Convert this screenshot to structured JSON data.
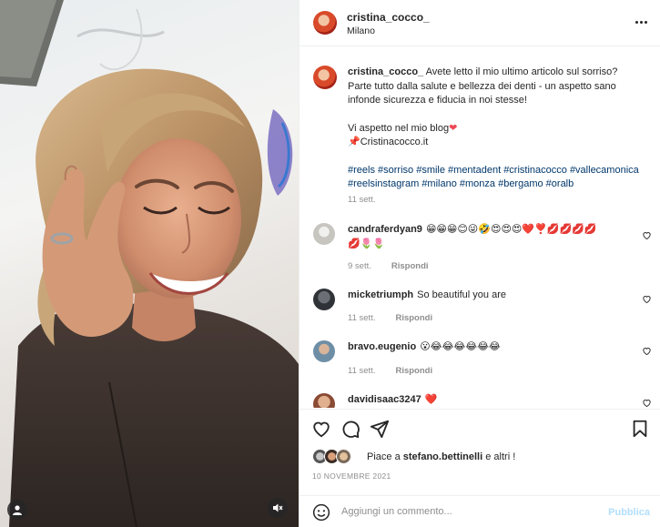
{
  "post": {
    "username": "cristina_cocco_",
    "location": "Milano",
    "caption_line1": "Avete letto il mio ultimo articolo sul sorriso?",
    "caption_line2": "Parte tutto dalla salute e bellezza dei denti - un aspetto sano",
    "caption_line3": "infonde sicurezza e fiducia in noi stesse!",
    "caption_line4": "Vi aspetto nel mio blog",
    "caption_line5": "Cristinacocco.it",
    "hashtags_line1": "#reels #sorriso #smile #mentadent #cristinacocco #vallecamonica",
    "hashtags_line2": "#reelsinstagram #milano #monza #bergamo #oralb",
    "caption_time": "11 sett."
  },
  "comments": [
    {
      "username": "candraferdyan9",
      "text": "😁😁😁😊😜🤣😍😍😍❤️❣️💋💋💋💋",
      "text2": "💋🌷🌷",
      "time": "9 sett.",
      "reply": "Rispondi"
    },
    {
      "username": "micketriumph",
      "text": "So beautiful you are",
      "time": "11 sett.",
      "reply": "Rispondi"
    },
    {
      "username": "bravo.eugenio",
      "text": "😮😂😂😂😂😂😂",
      "time": "11 sett.",
      "reply": "Rispondi"
    },
    {
      "username": "davidisaac3247",
      "text": "❤️"
    }
  ],
  "likes": {
    "prefix": "Piace a",
    "user": "stefano.bettinelli",
    "suffix": "e altri !"
  },
  "date": "10 NOVEMBRE 2021",
  "add_comment": {
    "placeholder": "Aggiungi un commento...",
    "publish": "Pubblica"
  },
  "icons": {
    "more": "more-horizontal-icon",
    "like": "heart-icon",
    "comment": "comment-icon",
    "share": "share-icon",
    "save": "bookmark-icon",
    "emoji": "emoji-icon",
    "mute": "muted-speaker-icon",
    "user": "user-icon"
  },
  "colors": {
    "link": "#00376b",
    "muted": "#8e8e8e",
    "publish": "#b2dffc",
    "heart": "#ed4956"
  }
}
